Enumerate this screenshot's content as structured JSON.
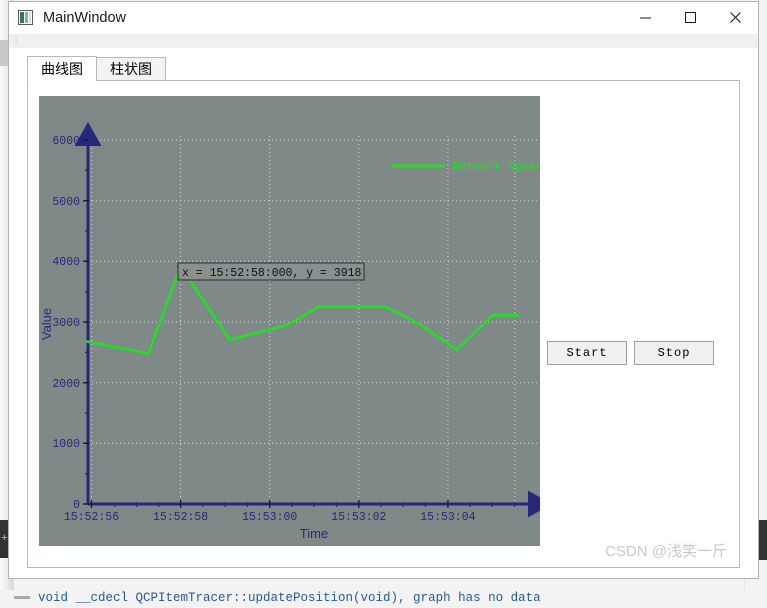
{
  "window": {
    "title": "MainWindow",
    "icon": "app-icon",
    "controls": {
      "minimize": "minimize-icon",
      "maximize": "maximize-icon",
      "close": "close-icon"
    }
  },
  "tabs": [
    {
      "label": "曲线图",
      "active": true
    },
    {
      "label": "柱状图",
      "active": false
    }
  ],
  "buttons": {
    "start": "Start",
    "stop": "Stop"
  },
  "tooltip": {
    "text": "x = 15:52:58:000,  y = 3918"
  },
  "watermark": {
    "text": "CSDN @浅笑一斤"
  },
  "background": {
    "console_line": "void __cdecl QCPItemTracer::updatePosition(void), graph has no data"
  },
  "colors": {
    "plot_background": "#7f8a88",
    "axis": "#28287a",
    "grid": "#d8dcda",
    "series": "#20e020",
    "tracer": "#ff0000",
    "tooltip_fill": "#8a908d",
    "accent": "#0078d7"
  },
  "chart_data": {
    "type": "line",
    "title": "",
    "xlabel": "Time",
    "ylabel": "Value",
    "grid": true,
    "legend": {
      "position": "top-right",
      "entries": [
        "Network Speed"
      ]
    },
    "ylim": [
      0,
      6200
    ],
    "ytick_values": [
      0,
      1000,
      2000,
      3000,
      4000,
      5000,
      6000
    ],
    "ytick_labels": [
      "0",
      "1000",
      "2000",
      "3000",
      "4000",
      "5000",
      "6000"
    ],
    "xtick_labels": [
      "15:52:56",
      "15:52:58",
      "15:53:00",
      "15:53:02",
      "15:53:04"
    ],
    "xtick_seconds": [
      56,
      58,
      60,
      62,
      64
    ],
    "xlim_seconds": [
      55.5,
      65.6
    ],
    "series": [
      {
        "name": "Network Speed",
        "color": "#20e020",
        "x_seconds": [
          55.6,
          57.0,
          58.0,
          59.1,
          60.4,
          61.1,
          62.6,
          63.4,
          64.2,
          65.0,
          65.6
        ],
        "values": [
          2680,
          2480,
          3918,
          2710,
          2950,
          3250,
          3250,
          2950,
          2540,
          3110,
          3110
        ]
      }
    ],
    "tracer": {
      "x_label": "15:52:58:000",
      "x_seconds": 58.0,
      "y": 3918
    }
  }
}
